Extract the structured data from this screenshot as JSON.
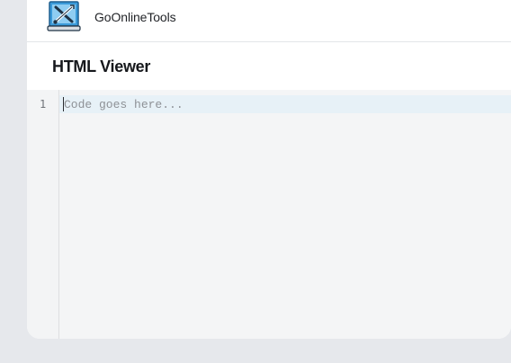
{
  "brand": {
    "name": "GoOnlineTools",
    "logo_icon": "laptop-tools-icon"
  },
  "page": {
    "title": "HTML Viewer"
  },
  "editor": {
    "line_numbers": [
      "1"
    ],
    "placeholder": "Code goes here..."
  },
  "colors": {
    "background": "#e6e8ec",
    "card": "#ffffff",
    "editor_bg": "#f4f5f6",
    "active_line": "#e7f1f7",
    "logo_blue": "#3b9ad9"
  }
}
